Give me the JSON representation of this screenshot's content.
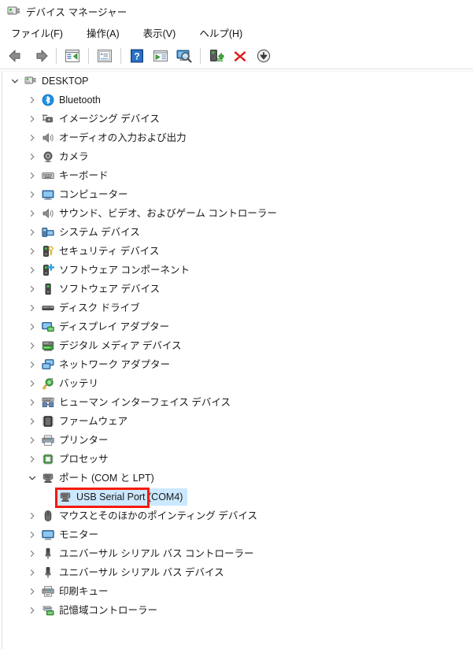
{
  "window": {
    "title": "デバイス マネージャー",
    "icon": "device-manager-icon"
  },
  "menu": {
    "items": [
      {
        "label": "ファイル(F)",
        "name": "menu-file"
      },
      {
        "label": "操作(A)",
        "name": "menu-action"
      },
      {
        "label": "表示(V)",
        "name": "menu-view"
      },
      {
        "label": "ヘルプ(H)",
        "name": "menu-help"
      }
    ]
  },
  "toolbar": {
    "buttons": [
      {
        "name": "back-icon",
        "tip": "戻る"
      },
      {
        "name": "forward-icon",
        "tip": "進む"
      },
      {
        "name": "separator-1",
        "tip": ""
      },
      {
        "name": "show-hide-console-tree-icon",
        "tip": "コンソール ツリーの表示/非表示"
      },
      {
        "name": "separator-2",
        "tip": ""
      },
      {
        "name": "properties-icon",
        "tip": "プロパティ"
      },
      {
        "name": "separator-3",
        "tip": ""
      },
      {
        "name": "help-icon",
        "tip": "ヘルプ"
      },
      {
        "name": "update-driver-icon",
        "tip": "ドライバーの更新"
      },
      {
        "name": "scan-hardware-changes-icon",
        "tip": "ハードウェア変更のスキャン"
      },
      {
        "name": "separator-4",
        "tip": ""
      },
      {
        "name": "enable-device-icon",
        "tip": "デバイスを有効にする"
      },
      {
        "name": "uninstall-device-icon",
        "tip": "デバイスのアンインストール"
      },
      {
        "name": "disable-device-icon",
        "tip": "デバイスを無効にする"
      }
    ]
  },
  "tree": {
    "nodes": [
      {
        "label": "DESKTOP",
        "depth": 0,
        "expander": "expanded",
        "icon": "computer-root-icon",
        "selected": false
      },
      {
        "label": "Bluetooth",
        "depth": 1,
        "expander": "collapsed",
        "icon": "bluetooth-icon",
        "selected": false
      },
      {
        "label": "イメージング デバイス",
        "depth": 1,
        "expander": "collapsed",
        "icon": "imaging-device-icon",
        "selected": false
      },
      {
        "label": "オーディオの入力および出力",
        "depth": 1,
        "expander": "collapsed",
        "icon": "audio-io-icon",
        "selected": false
      },
      {
        "label": "カメラ",
        "depth": 1,
        "expander": "collapsed",
        "icon": "camera-icon",
        "selected": false
      },
      {
        "label": "キーボード",
        "depth": 1,
        "expander": "collapsed",
        "icon": "keyboard-icon",
        "selected": false
      },
      {
        "label": "コンピューター",
        "depth": 1,
        "expander": "collapsed",
        "icon": "computer-icon",
        "selected": false
      },
      {
        "label": "サウンド、ビデオ、およびゲーム コントローラー",
        "depth": 1,
        "expander": "collapsed",
        "icon": "sound-video-game-icon",
        "selected": false
      },
      {
        "label": "システム デバイス",
        "depth": 1,
        "expander": "collapsed",
        "icon": "system-device-icon",
        "selected": false
      },
      {
        "label": "セキュリティ デバイス",
        "depth": 1,
        "expander": "collapsed",
        "icon": "security-device-icon",
        "selected": false
      },
      {
        "label": "ソフトウェア コンポーネント",
        "depth": 1,
        "expander": "collapsed",
        "icon": "software-component-icon",
        "selected": false
      },
      {
        "label": "ソフトウェア デバイス",
        "depth": 1,
        "expander": "collapsed",
        "icon": "software-device-icon",
        "selected": false
      },
      {
        "label": "ディスク ドライブ",
        "depth": 1,
        "expander": "collapsed",
        "icon": "disk-drive-icon",
        "selected": false
      },
      {
        "label": "ディスプレイ アダプター",
        "depth": 1,
        "expander": "collapsed",
        "icon": "display-adapter-icon",
        "selected": false
      },
      {
        "label": "デジタル メディア デバイス",
        "depth": 1,
        "expander": "collapsed",
        "icon": "digital-media-device-icon",
        "selected": false
      },
      {
        "label": "ネットワーク アダプター",
        "depth": 1,
        "expander": "collapsed",
        "icon": "network-adapter-icon",
        "selected": false
      },
      {
        "label": "バッテリ",
        "depth": 1,
        "expander": "collapsed",
        "icon": "battery-icon",
        "selected": false
      },
      {
        "label": "ヒューマン インターフェイス デバイス",
        "depth": 1,
        "expander": "collapsed",
        "icon": "hid-icon",
        "selected": false
      },
      {
        "label": "ファームウェア",
        "depth": 1,
        "expander": "collapsed",
        "icon": "firmware-icon",
        "selected": false
      },
      {
        "label": "プリンター",
        "depth": 1,
        "expander": "collapsed",
        "icon": "printer-icon",
        "selected": false
      },
      {
        "label": "プロセッサ",
        "depth": 1,
        "expander": "collapsed",
        "icon": "processor-icon",
        "selected": false
      },
      {
        "label": "ポート (COM と LPT)",
        "depth": 1,
        "expander": "expanded",
        "icon": "port-icon",
        "selected": false
      },
      {
        "label": "USB Serial Port (COM4)",
        "depth": 2,
        "expander": "none",
        "icon": "serial-port-icon",
        "selected": true
      },
      {
        "label": "マウスとそのほかのポインティング デバイス",
        "depth": 1,
        "expander": "collapsed",
        "icon": "mouse-icon",
        "selected": false
      },
      {
        "label": "モニター",
        "depth": 1,
        "expander": "collapsed",
        "icon": "monitor-icon",
        "selected": false
      },
      {
        "label": "ユニバーサル シリアル バス コントローラー",
        "depth": 1,
        "expander": "collapsed",
        "icon": "usb-controller-icon",
        "selected": false
      },
      {
        "label": "ユニバーサル シリアル バス デバイス",
        "depth": 1,
        "expander": "collapsed",
        "icon": "usb-device-icon",
        "selected": false
      },
      {
        "label": "印刷キュー",
        "depth": 1,
        "expander": "collapsed",
        "icon": "print-queue-icon",
        "selected": false
      },
      {
        "label": "記憶域コントローラー",
        "depth": 1,
        "expander": "collapsed",
        "icon": "storage-controller-icon",
        "selected": false
      }
    ]
  },
  "annotation": {
    "highlight_color": "#f61a0a",
    "selection_color": "#cce8ff",
    "target_label": "USB Serial Port"
  }
}
